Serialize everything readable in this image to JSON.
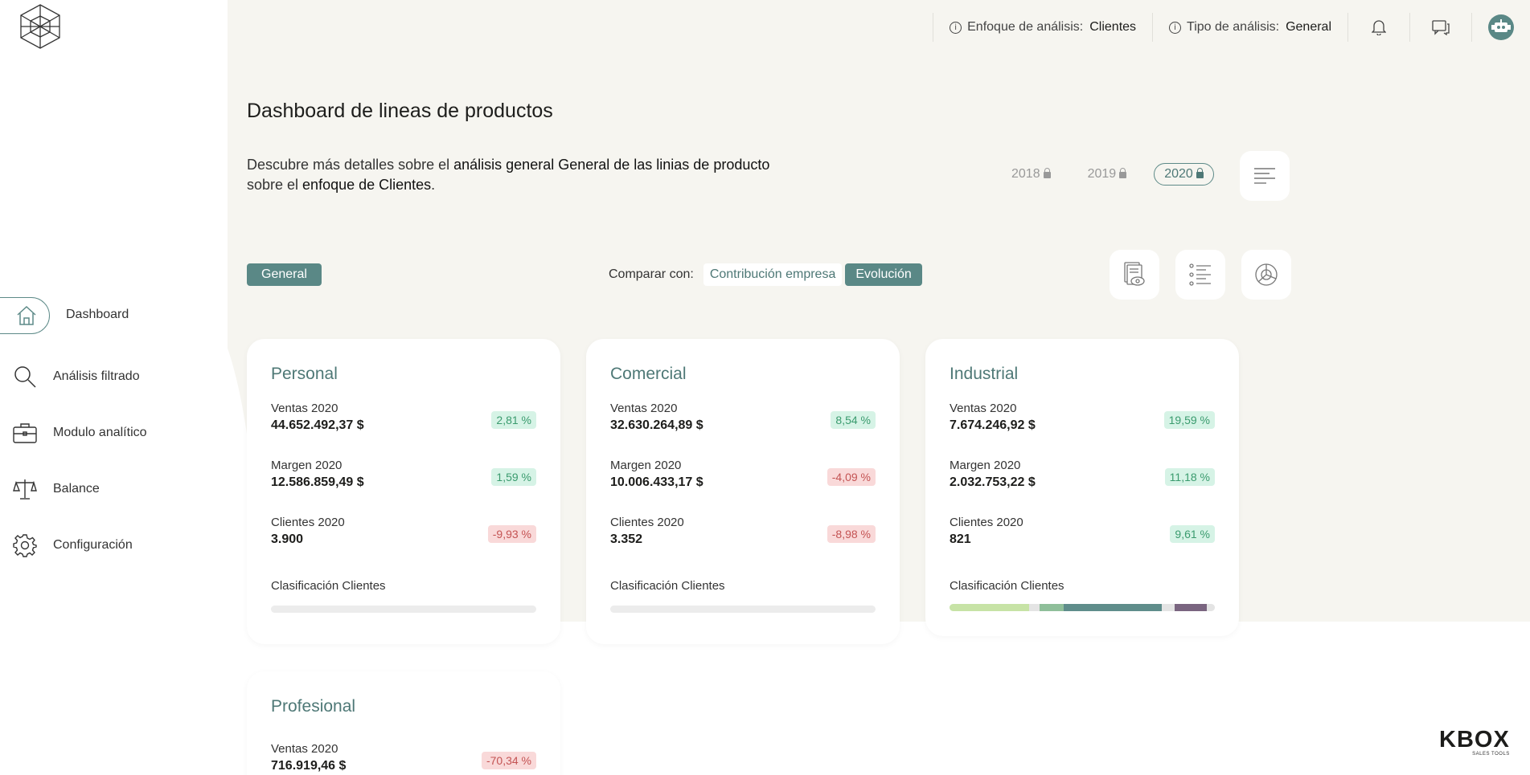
{
  "header": {
    "focus_label": "Enfoque de análisis:",
    "focus_value": "Clientes",
    "type_label": "Tipo de análisis:",
    "type_value": "General"
  },
  "sidebar": {
    "items": [
      {
        "label": "Dashboard",
        "icon": "home-icon",
        "active": true
      },
      {
        "label": "Análisis filtrado",
        "icon": "search-icon"
      },
      {
        "label": "Modulo analítico",
        "icon": "briefcase-icon"
      },
      {
        "label": "Balance",
        "icon": "scale-icon"
      },
      {
        "label": "Configuración",
        "icon": "gear-icon"
      }
    ]
  },
  "page": {
    "title": "Dashboard de lineas de productos",
    "desc_1": "Descubre más detalles sobre el ",
    "desc_2": "análisis general General de las linias de producto",
    "desc_3": "sobre el ",
    "desc_4": "enfoque de Clientes",
    "desc_5": "."
  },
  "years": [
    "2018",
    "2019",
    "2020"
  ],
  "selected_year": "2020",
  "filters": {
    "general_label": "General",
    "compare_label": "Comparar con:",
    "option_contribution": "Contribución empresa",
    "option_evolution": "Evolución"
  },
  "cards": [
    {
      "title": "Personal",
      "metrics": [
        {
          "label": "Ventas 2020",
          "value": "44.652.492,37 $",
          "change": "2,81 %",
          "trend": "pos"
        },
        {
          "label": "Margen 2020",
          "value": "12.586.859,49 $",
          "change": "1,59 %",
          "trend": "pos"
        },
        {
          "label": "Clientes 2020",
          "value": "3.900",
          "change": "-9,93 %",
          "trend": "neg"
        }
      ],
      "classification_label": "Clasificación Clientes"
    },
    {
      "title": "Comercial",
      "metrics": [
        {
          "label": "Ventas 2020",
          "value": "32.630.264,89 $",
          "change": "8,54 %",
          "trend": "pos"
        },
        {
          "label": "Margen 2020",
          "value": "10.006.433,17 $",
          "change": "-4,09 %",
          "trend": "neg"
        },
        {
          "label": "Clientes 2020",
          "value": "3.352",
          "change": "-8,98 %",
          "trend": "neg"
        }
      ],
      "classification_label": "Clasificación Clientes"
    },
    {
      "title": "Industrial",
      "metrics": [
        {
          "label": "Ventas 2020",
          "value": "7.674.246,92 $",
          "change": "19,59 %",
          "trend": "pos"
        },
        {
          "label": "Margen 2020",
          "value": "2.032.753,22 $",
          "change": "11,18 %",
          "trend": "pos"
        },
        {
          "label": "Clientes 2020",
          "value": "821",
          "change": "9,61 %",
          "trend": "pos"
        }
      ],
      "classification_label": "Clasificación Clientes",
      "classification_segments": [
        {
          "share": 0.3,
          "color": "#c7e3a6"
        },
        {
          "share": 0.04,
          "color": "#e4e4e4"
        },
        {
          "share": 0.09,
          "color": "#8fbf9a"
        },
        {
          "share": 0.37,
          "color": "#5f8d8b"
        },
        {
          "share": 0.05,
          "color": "#e4e4e4"
        },
        {
          "share": 0.12,
          "color": "#7a6580"
        },
        {
          "share": 0.03,
          "color": "#e4e4e4"
        }
      ]
    },
    {
      "title": "Profesional",
      "metrics": [
        {
          "label": "Ventas 2020",
          "value": "716.919,46 $",
          "change": "-70,34 %",
          "trend": "neg"
        }
      ]
    }
  ],
  "brand": {
    "name": "KBOX",
    "tagline": "SALES TOOLS"
  },
  "colors": {
    "accent": "#5a8886",
    "background": "#f6f5f0",
    "positive": "#3a9b6e",
    "negative": "#c45353"
  }
}
